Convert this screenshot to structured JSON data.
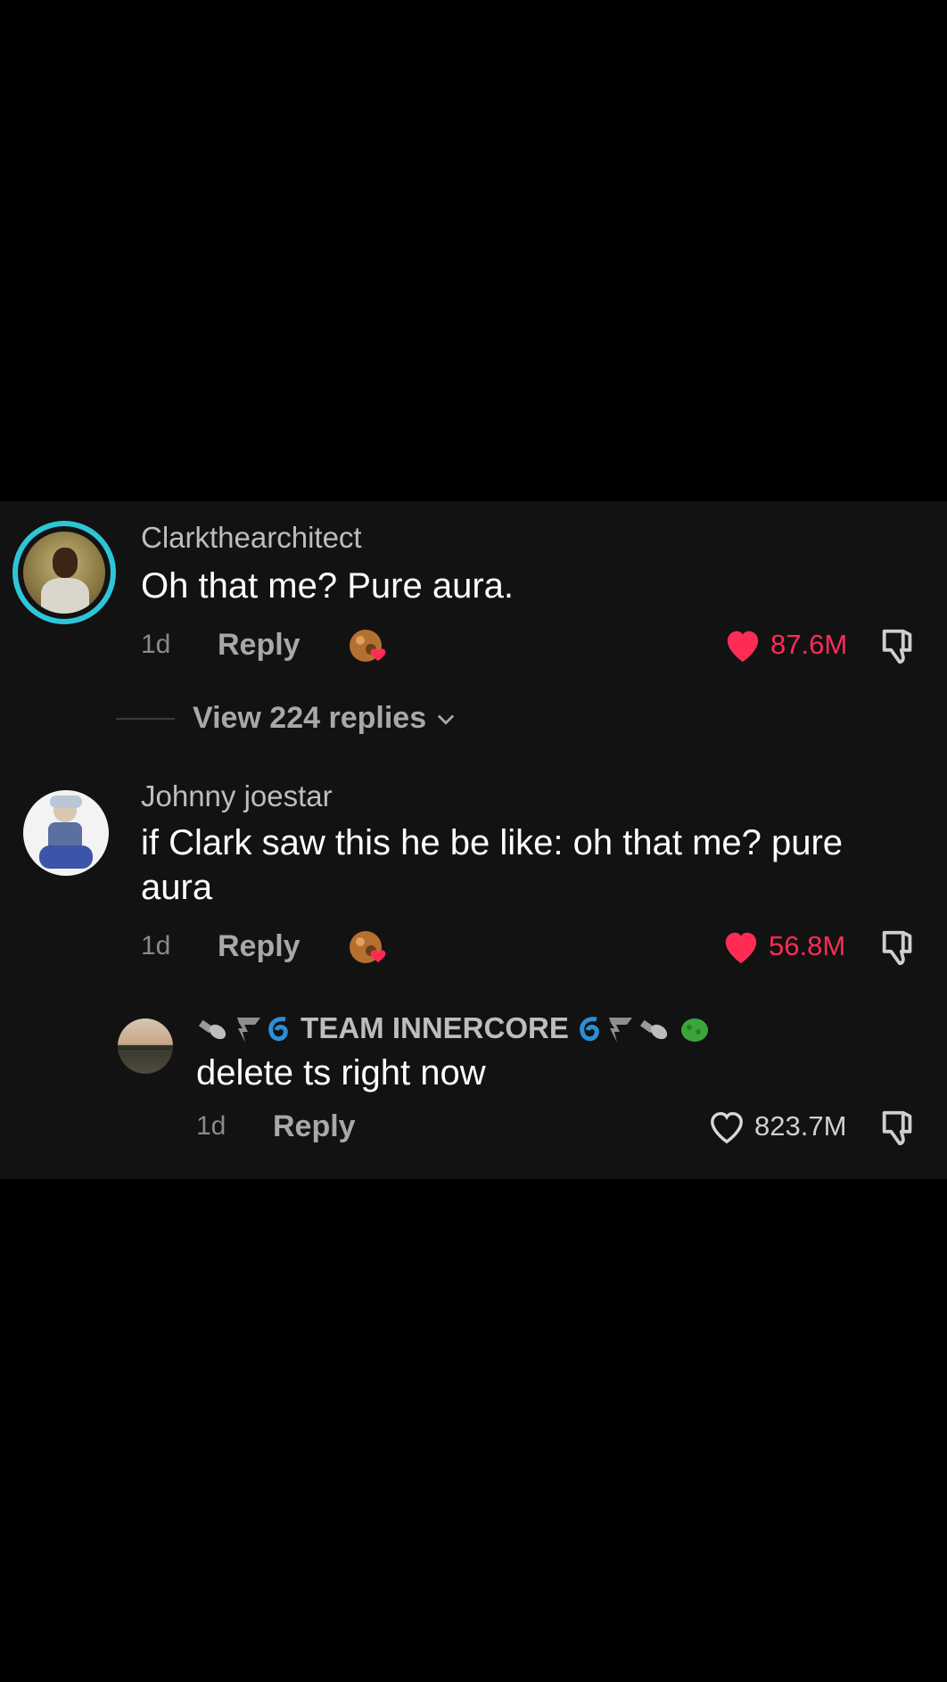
{
  "colors": {
    "accent_pink": "#fe2c55",
    "panel_bg": "#121212",
    "ring": "#2ec5d8"
  },
  "comments": [
    {
      "username": "Clarkthearchitect",
      "text": "Oh that me? Pure aura.",
      "age": "1d",
      "reply_label": "Reply",
      "likes": "87.6M",
      "liked": true
    },
    {
      "username": "Johnny joestar",
      "text": "if Clark saw this he be like: oh that me? pure aura",
      "age": "1d",
      "reply_label": "Reply",
      "likes": "56.8M",
      "liked": true
    }
  ],
  "view_replies": "View 224 replies",
  "reply": {
    "username_text": "TEAM INNERCORE",
    "text": "delete ts right now",
    "age": "1d",
    "reply_label": "Reply",
    "likes": "823.7M",
    "liked": false
  }
}
